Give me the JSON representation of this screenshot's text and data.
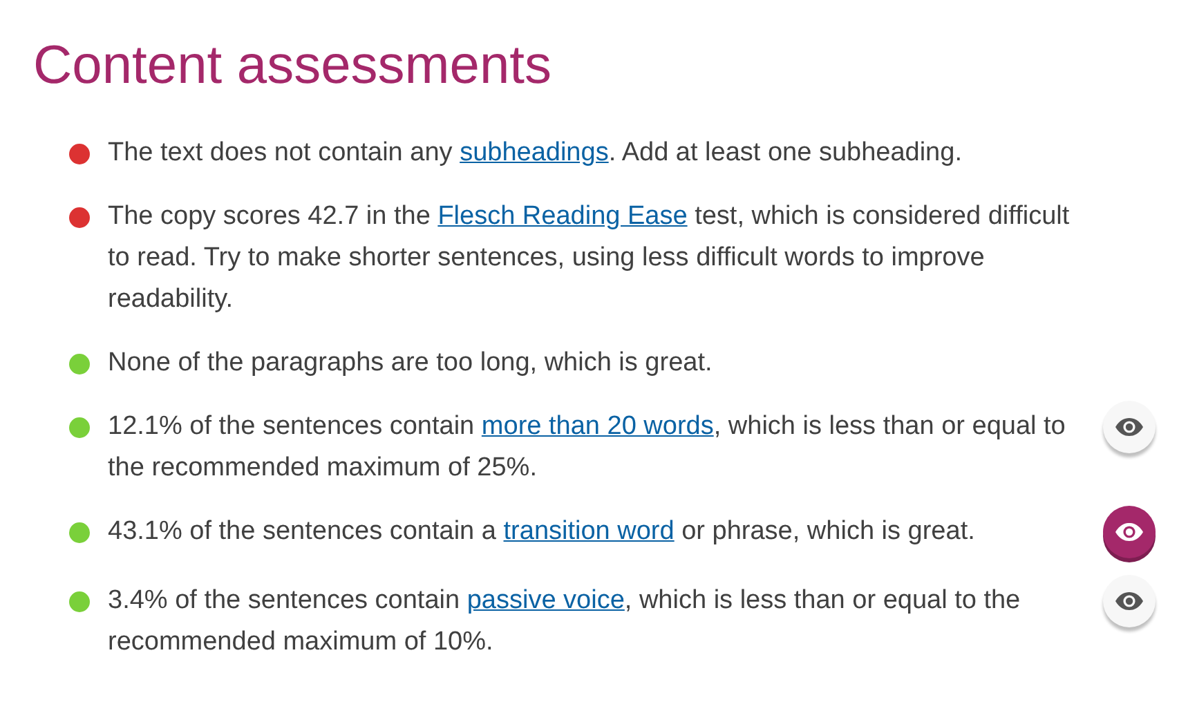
{
  "title": "Content assessments",
  "items": [
    {
      "color": "#dc3232",
      "before": "The text does not contain any ",
      "link": "subheadings",
      "after": ". Add at least one subheading."
    },
    {
      "color": "#dc3232",
      "before": "The copy scores 42.7 in the ",
      "link": "Flesch Reading Ease",
      "after": " test, which is considered difficult to read. Try to make shorter sentences, using less difficult words to improve readability."
    },
    {
      "color": "#7ad03a",
      "before": "None of the paragraphs are too long, which is great."
    },
    {
      "color": "#7ad03a",
      "before": "12.1% of the sentences contain ",
      "link": "more than 20 words",
      "after": ", which is less than or equal to the recommended maximum of 25%.",
      "highlight": {
        "selected": false
      }
    },
    {
      "color": "#7ad03a",
      "before": "43.1% of the sentences contain a ",
      "link": "transition word",
      "after": " or phrase, which is great.",
      "highlight": {
        "selected": true
      }
    },
    {
      "color": "#7ad03a",
      "before": "3.4% of the sentences contain ",
      "link": "passive voice",
      "after": ", which is less than or equal to the recommended maximum of 10%.",
      "highlight": {
        "selected": false
      }
    }
  ]
}
